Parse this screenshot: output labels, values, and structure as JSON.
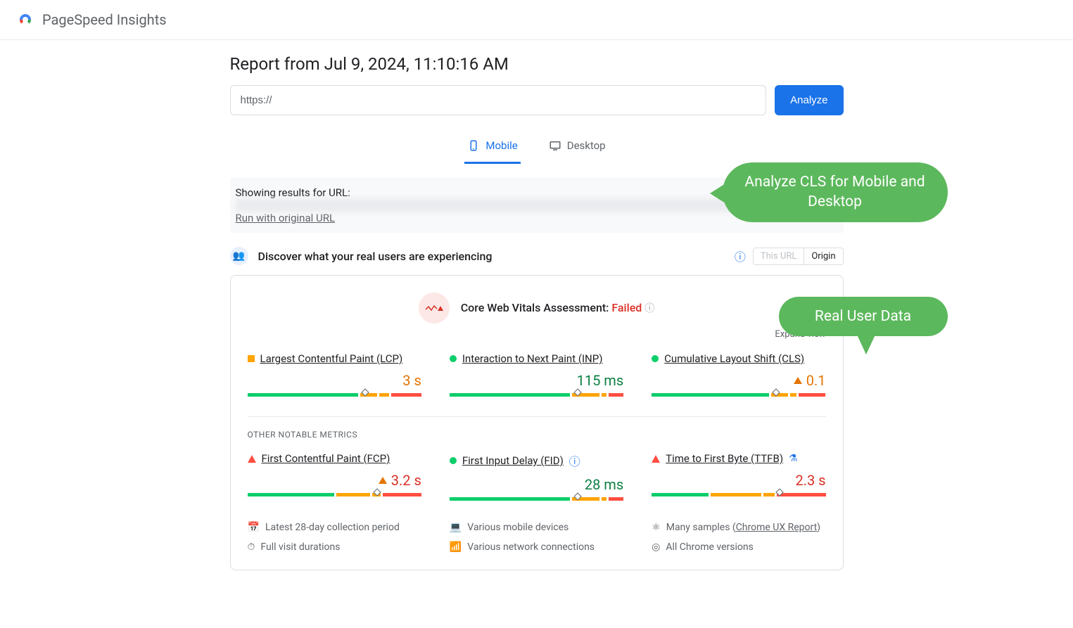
{
  "app_title": "PageSpeed Insights",
  "report_title": "Report from Jul 9, 2024, 11:10:16 AM",
  "url_input": "https://",
  "analyze_btn": "Analyze",
  "tabs": {
    "mobile": "Mobile",
    "desktop": "Desktop"
  },
  "callouts": {
    "c1": "Analyze CLS for Mobile and Desktop",
    "c2": "Real User Data"
  },
  "results": {
    "label": "Showing results for URL:",
    "run_link": "Run with original URL"
  },
  "discover": {
    "text": "Discover what your real users are experiencing",
    "toggle_url": "This URL",
    "toggle_origin": "Origin"
  },
  "cwv": {
    "label": "Core Web Vitals Assessment:",
    "status": "Failed"
  },
  "expand": "Expand view",
  "section_other": "OTHER NOTABLE METRICS",
  "metrics": {
    "lcp": {
      "name": "Largest Contentful Paint (LCP)",
      "value": "3 s",
      "status": "amber",
      "bar": [
        66,
        10,
        6,
        18
      ],
      "marker": 66
    },
    "inp": {
      "name": "Interaction to Next Paint (INP)",
      "value": "115 ms",
      "status": "green",
      "bar": [
        72,
        16,
        3,
        9
      ],
      "marker": 72
    },
    "cls": {
      "name": "Cumulative Layout Shift (CLS)",
      "value": "0.1",
      "status": "green",
      "bar": [
        70,
        10,
        4,
        16
      ],
      "marker": 70,
      "warn": true
    },
    "fcp": {
      "name": "First Contentful Paint (FCP)",
      "value": "3.2 s",
      "status": "red",
      "bar": [
        52,
        20,
        5,
        23
      ],
      "marker": 73,
      "warn": true
    },
    "fid": {
      "name": "First Input Delay (FID)",
      "value": "28 ms",
      "status": "green",
      "bar": [
        72,
        16,
        3,
        9
      ],
      "marker": 72,
      "info": true
    },
    "ttfb": {
      "name": "Time to First Byte (TTFB)",
      "value": "2.3 s",
      "status": "red",
      "bar": [
        34,
        30,
        7,
        29
      ],
      "marker": 72,
      "flask": true
    }
  },
  "footer": {
    "f1": "Latest 28-day collection period",
    "f2": "Various mobile devices",
    "f3a": "Many samples (",
    "f3b": "Chrome UX Report",
    "f3c": ")",
    "f4": "Full visit durations",
    "f5": "Various network connections",
    "f6": "All Chrome versions"
  }
}
